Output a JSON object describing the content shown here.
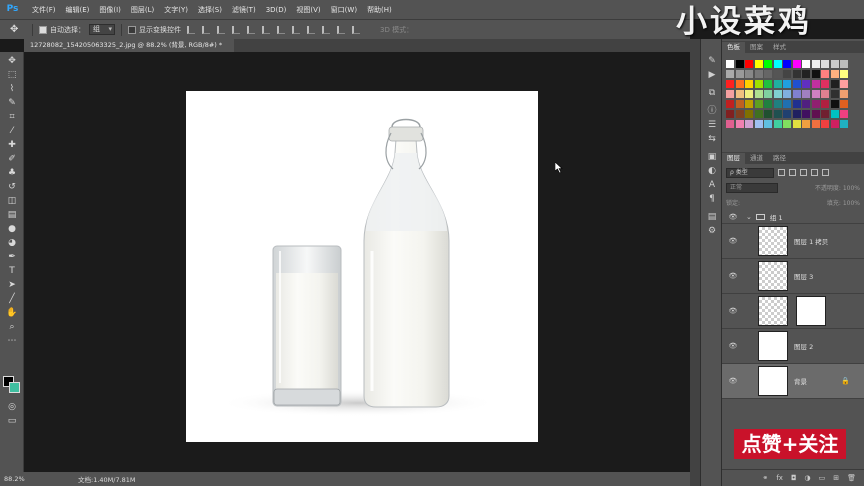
{
  "app": {
    "logo": "Ps"
  },
  "menu": [
    "文件(F)",
    "编辑(E)",
    "图像(I)",
    "图层(L)",
    "文字(Y)",
    "选择(S)",
    "滤镜(T)",
    "3D(D)",
    "视图(V)",
    "窗口(W)",
    "帮助(H)"
  ],
  "options": {
    "auto_select_label": "自动选择：",
    "auto_select_value": "组",
    "show_transform_label": "显示变换控件",
    "mode_3d_label": "3D 模式："
  },
  "document": {
    "tab_title": "12728082_154205063325_2.jpg @ 88.2% (背景, RGB/8#) *"
  },
  "status": {
    "zoom": "88.2%",
    "doc_info": "文档:1.40M/7.81M"
  },
  "watermark": "小设菜鸡",
  "panels": {
    "swatch_tabs": [
      "色板",
      "图案",
      "样式"
    ],
    "layer_tabs": [
      "图层",
      "通道",
      "路径"
    ],
    "filter_kind": "ρ 类型",
    "blend_mode": "正常",
    "opacity_label": "不透明度: 100%",
    "lock_label": "锁定:",
    "fill_label": "填充: 100%"
  },
  "swatch_colors": [
    "#ffffff",
    "#000000",
    "#ff0000",
    "#ffff00",
    "#00ff00",
    "#00ffff",
    "#0000ff",
    "#ff00ff",
    "#ffffff",
    "#eeeeee",
    "#dddddd",
    "#cccccc",
    "#bbbbbb",
    "#aaaaaa",
    "#999999",
    "#888888",
    "#777777",
    "#666666",
    "#555555",
    "#444444",
    "#333333",
    "#222222",
    "#111111",
    "#ff8080",
    "#ffb080",
    "#ffff80",
    "#ff2020",
    "#ff7020",
    "#ffd000",
    "#a0e000",
    "#20c040",
    "#20b0a0",
    "#20a0e0",
    "#2050d0",
    "#6030c0",
    "#c030a0",
    "#e03060",
    "#202020",
    "#ffa0a0",
    "#f4a0a0",
    "#f0c080",
    "#f0f080",
    "#b0e090",
    "#80d0a0",
    "#80d0d0",
    "#80b0e0",
    "#8080d0",
    "#a080c0",
    "#d080c0",
    "#e08090",
    "#303030",
    "#f0a070",
    "#c02020",
    "#c06020",
    "#c0a000",
    "#60a020",
    "#208040",
    "#208080",
    "#2070b0",
    "#203090",
    "#502080",
    "#902070",
    "#b02040",
    "#101010",
    "#e06020",
    "#802020",
    "#804020",
    "#807000",
    "#407020",
    "#205030",
    "#205050",
    "#204070",
    "#202060",
    "#401060",
    "#601050",
    "#702030",
    "#00c0c0",
    "#f04080",
    "#e06090",
    "#f080b0",
    "#d0a0d0",
    "#a0c0f0",
    "#60c0e0",
    "#40d0a0",
    "#80e060",
    "#e0e040",
    "#f0a040",
    "#f07040",
    "#f04040",
    "#d02060",
    "#20b0c0"
  ],
  "layers": [
    {
      "name": "组 1",
      "type": "group"
    },
    {
      "name": "图层 1 拷贝",
      "type": "image"
    },
    {
      "name": "图层 3",
      "type": "image"
    },
    {
      "name": "",
      "type": "masked"
    },
    {
      "name": "图层 2",
      "type": "white"
    },
    {
      "name": "背景",
      "type": "background",
      "selected": true
    }
  ],
  "promo": "点赞+关注"
}
